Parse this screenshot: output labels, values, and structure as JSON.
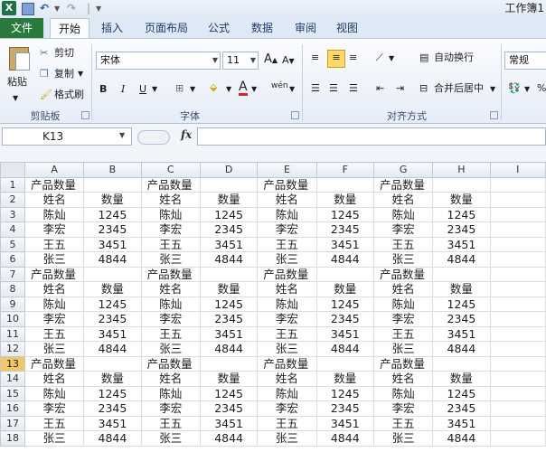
{
  "titlebar": {
    "app_icon_letter": "X",
    "window_title": "工作簿1"
  },
  "tabs": [
    {
      "label": "文件",
      "selected": false
    },
    {
      "label": "开始",
      "selected": true
    },
    {
      "label": "插入",
      "selected": false
    },
    {
      "label": "页面布局",
      "selected": false
    },
    {
      "label": "公式",
      "selected": false
    },
    {
      "label": "数据",
      "selected": false
    },
    {
      "label": "审阅",
      "selected": false
    },
    {
      "label": "视图",
      "selected": false
    }
  ],
  "ribbon": {
    "clipboard": {
      "paste_label": "粘贴",
      "cut_label": "剪切",
      "copy_label": "复制",
      "format_painter_label": "格式刷",
      "group_label": "剪贴板"
    },
    "font": {
      "font_name": "宋体",
      "font_size": "11",
      "bold": "B",
      "italic": "I",
      "underline": "U",
      "grow": "A",
      "shrink": "A",
      "font_color_letter": "A",
      "phonetic": "wén",
      "group_label": "字体"
    },
    "alignment": {
      "wrap_label": "自动换行",
      "merge_label": "合并后居中",
      "group_label": "对齐方式"
    },
    "number": {
      "format_value": "常规",
      "percent": "%"
    }
  },
  "formula_bar": {
    "name_box": "K13",
    "fx": "fx",
    "formula": ""
  },
  "sheet": {
    "columns": [
      "A",
      "B",
      "C",
      "D",
      "E",
      "F",
      "G",
      "H",
      "I"
    ],
    "active_row": 13,
    "block_title": "产品数量",
    "header_name": "姓名",
    "header_qty": "数量",
    "rows": [
      {
        "n": "1",
        "cells": [
          "产品数量",
          "",
          "产品数量",
          "",
          "产品数量",
          "",
          "产品数量",
          "",
          ""
        ]
      },
      {
        "n": "2",
        "cells": [
          "姓名",
          "数量",
          "姓名",
          "数量",
          "姓名",
          "数量",
          "姓名",
          "数量",
          ""
        ]
      },
      {
        "n": "3",
        "cells": [
          "陈灿",
          "1245",
          "陈灿",
          "1245",
          "陈灿",
          "1245",
          "陈灿",
          "1245",
          ""
        ]
      },
      {
        "n": "4",
        "cells": [
          "李宏",
          "2345",
          "李宏",
          "2345",
          "李宏",
          "2345",
          "李宏",
          "2345",
          ""
        ]
      },
      {
        "n": "5",
        "cells": [
          "王五",
          "3451",
          "王五",
          "3451",
          "王五",
          "3451",
          "王五",
          "3451",
          ""
        ]
      },
      {
        "n": "6",
        "cells": [
          "张三",
          "4844",
          "张三",
          "4844",
          "张三",
          "4844",
          "张三",
          "4844",
          ""
        ]
      },
      {
        "n": "7",
        "cells": [
          "产品数量",
          "",
          "产品数量",
          "",
          "产品数量",
          "",
          "产品数量",
          "",
          ""
        ]
      },
      {
        "n": "8",
        "cells": [
          "姓名",
          "数量",
          "姓名",
          "数量",
          "姓名",
          "数量",
          "姓名",
          "数量",
          ""
        ]
      },
      {
        "n": "9",
        "cells": [
          "陈灿",
          "1245",
          "陈灿",
          "1245",
          "陈灿",
          "1245",
          "陈灿",
          "1245",
          ""
        ]
      },
      {
        "n": "10",
        "cells": [
          "李宏",
          "2345",
          "李宏",
          "2345",
          "李宏",
          "2345",
          "李宏",
          "2345",
          ""
        ]
      },
      {
        "n": "11",
        "cells": [
          "王五",
          "3451",
          "王五",
          "3451",
          "王五",
          "3451",
          "王五",
          "3451",
          ""
        ]
      },
      {
        "n": "12",
        "cells": [
          "张三",
          "4844",
          "张三",
          "4844",
          "张三",
          "4844",
          "张三",
          "4844",
          ""
        ]
      },
      {
        "n": "13",
        "cells": [
          "产品数量",
          "",
          "产品数量",
          "",
          "产品数量",
          "",
          "产品数量",
          "",
          ""
        ]
      },
      {
        "n": "14",
        "cells": [
          "姓名",
          "数量",
          "姓名",
          "数量",
          "姓名",
          "数量",
          "姓名",
          "数量",
          ""
        ]
      },
      {
        "n": "15",
        "cells": [
          "陈灿",
          "1245",
          "陈灿",
          "1245",
          "陈灿",
          "1245",
          "陈灿",
          "1245",
          ""
        ]
      },
      {
        "n": "16",
        "cells": [
          "李宏",
          "2345",
          "李宏",
          "2345",
          "李宏",
          "2345",
          "李宏",
          "2345",
          ""
        ]
      },
      {
        "n": "17",
        "cells": [
          "王五",
          "3451",
          "王五",
          "3451",
          "王五",
          "3451",
          "王五",
          "3451",
          ""
        ]
      },
      {
        "n": "18",
        "cells": [
          "张三",
          "4844",
          "张三",
          "4844",
          "张三",
          "4844",
          "张三",
          "4844",
          ""
        ]
      }
    ]
  },
  "colors": {
    "file_tab": "#2b7a3d",
    "active_row_header": "#f3c766",
    "ribbon_bg": "#e6edf7"
  }
}
